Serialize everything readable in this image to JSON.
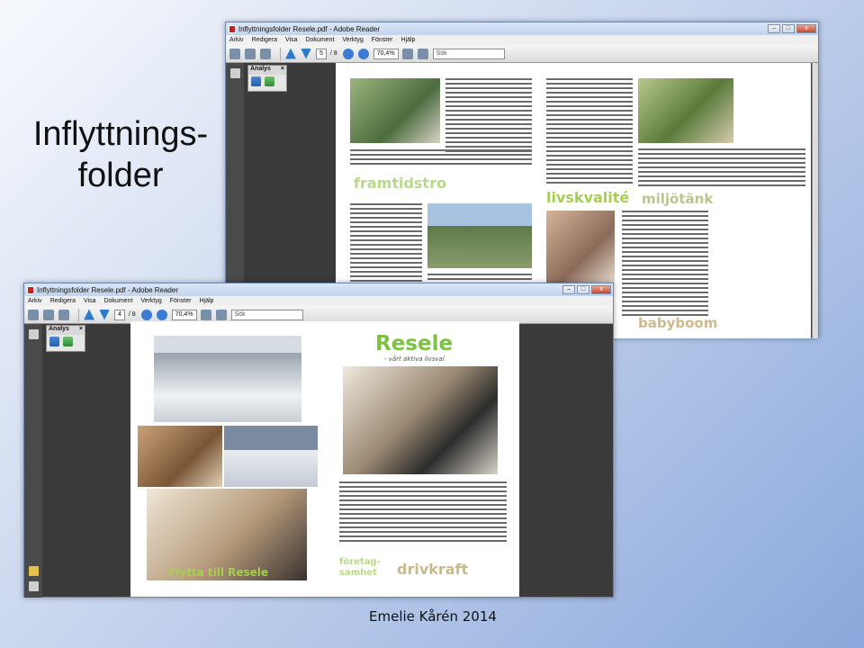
{
  "slide": {
    "title_line1": "Inflyttnings-",
    "title_line2": "folder",
    "footer": "Emelie Kårén 2014"
  },
  "window_back": {
    "title": "Inflyttningsfolder Resele.pdf - Adobe Reader",
    "menu": [
      "Arkiv",
      "Redigera",
      "Visa",
      "Dokument",
      "Verktyg",
      "Fönster",
      "Hjälp"
    ],
    "page_current": "5",
    "page_total": "/ 8",
    "zoom": "70,4%",
    "search_placeholder": "Sök",
    "panel_title": "Analys",
    "panel_close": "×",
    "headings": {
      "framtidstro": "framtidstro",
      "livskvalite": "livskvalité",
      "miljotank": "miljötänk",
      "babyboom": "babyboom"
    }
  },
  "window_front": {
    "title": "Inflyttningsfolder Resele.pdf - Adobe Reader",
    "menu": [
      "Arkiv",
      "Redigera",
      "Visa",
      "Dokument",
      "Verktyg",
      "Fönster",
      "Hjälp"
    ],
    "page_current": "4",
    "page_total": "/ 8",
    "zoom": "70,4%",
    "search_placeholder": "Sök",
    "panel_title": "Analys",
    "panel_close": "×",
    "headings": {
      "resele": "Resele",
      "tagline": "- vårt aktiva livsval",
      "flytta": "Flytta till Resele",
      "foretag1": "företag-",
      "foretag2": "samhet",
      "drivkraft": "drivkraft"
    }
  },
  "window_controls": {
    "minimize": "–",
    "maximize": "□",
    "close": "x"
  },
  "colors": {
    "accent_green": "#a6cf52",
    "reader_dark": "#3a3a3a",
    "slide_bg": "#c9d6ee"
  }
}
